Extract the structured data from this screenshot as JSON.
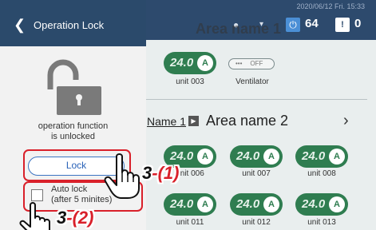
{
  "header": {
    "date": "2020/06/12 Fri. 15:33",
    "on_count": "64",
    "warning_count": "0",
    "area1_title": "Area name 1"
  },
  "background": {
    "units_top": [
      {
        "temp": "24.0",
        "mode": "A",
        "label": "unit 003"
      }
    ],
    "ventilator": {
      "status": "OFF",
      "label": "Ventilator"
    },
    "area2": {
      "link": "Name 1",
      "name": "Area name 2"
    },
    "units_row2": [
      {
        "temp": "24.0",
        "mode": "A",
        "label": "unit 006"
      },
      {
        "temp": "24.0",
        "mode": "A",
        "label": "unit 007"
      },
      {
        "temp": "24.0",
        "mode": "A",
        "label": "unit 008"
      }
    ],
    "units_row3": [
      {
        "temp": "24.0",
        "mode": "A",
        "label": "unit 011"
      },
      {
        "temp": "24.0",
        "mode": "A",
        "label": "unit 012"
      },
      {
        "temp": "24.0",
        "mode": "A",
        "label": "unit 013"
      }
    ]
  },
  "side_panel": {
    "title": "Operation Lock",
    "status_line1": "operation function",
    "status_line2": "is unlocked",
    "lock_button": "Lock",
    "autolock_line1": "Auto lock",
    "autolock_line2": "(after 5 minites)",
    "autolock_checked": false
  },
  "annotations": {
    "step1_num": "3",
    "step1_sub": "-(1)",
    "step2_num": "3",
    "step2_sub": "-(2)"
  },
  "icons": {
    "back": "chevron-left-icon",
    "lock": "open-padlock-icon",
    "power": "power-icon",
    "warning": "warning-icon"
  },
  "colors": {
    "header_bg": "#2b4a6b",
    "unit_green": "#2f7d50",
    "accent_blue": "#3b74c2",
    "annotation_red": "#d9202a"
  }
}
